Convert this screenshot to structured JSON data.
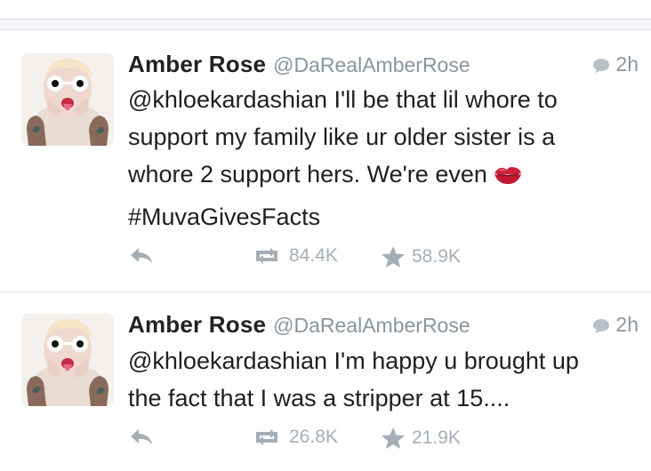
{
  "tweets": [
    {
      "name": "Amber Rose",
      "handle": "@DaRealAmberRose",
      "time": "2h",
      "lines": [
        "@khloekardashian I'll be that lil whore to",
        "support my family like ur older sister is a",
        "whore 2 support hers. We're even",
        "#MuvaGivesFacts"
      ],
      "emoji": "kiss-mark-icon",
      "retweets": "84.4K",
      "favorites": "58.9K"
    },
    {
      "name": "Amber Rose",
      "handle": "@DaRealAmberRose",
      "time": "2h",
      "lines": [
        "@khloekardashian I'm happy u brought up",
        "the fact that I was a stripper at 15...."
      ],
      "retweets": "26.8K",
      "favorites": "21.9K"
    }
  ],
  "colors": {
    "meta_gray": "#8a95a0",
    "action_gray": "#a5aeb7",
    "divider": "#d9dee5",
    "lip_red": "#d0203a"
  },
  "icons": [
    "reply-icon",
    "retweet-icon",
    "star-icon",
    "conversation-bubble-icon"
  ]
}
